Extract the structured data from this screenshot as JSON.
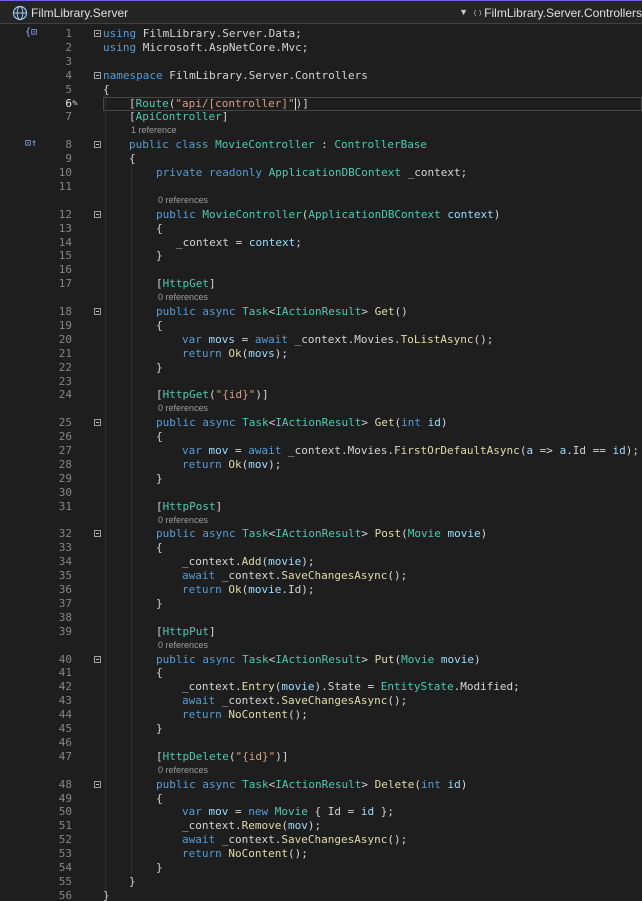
{
  "nav": {
    "project": "FilmLibrary.Server",
    "type": "FilmLibrary.Server.Controllers"
  },
  "lines": [
    {
      "n": "1",
      "indent": 0,
      "fold": true,
      "code": [
        [
          "kw",
          "using"
        ],
        [
          "t",
          " FilmLibrary.Server.Data;"
        ]
      ]
    },
    {
      "n": "2",
      "indent": 0,
      "code": [
        [
          "kw",
          "using"
        ],
        [
          "t",
          " Microsoft.AspNetCore.Mvc;"
        ]
      ]
    },
    {
      "n": "3",
      "indent": 0,
      "code": []
    },
    {
      "n": "4",
      "indent": 0,
      "fold": true,
      "code": [
        [
          "kw",
          "namespace"
        ],
        [
          "t",
          " FilmLibrary.Server.Controllers"
        ]
      ]
    },
    {
      "n": "5",
      "indent": 0,
      "code": [
        [
          "t",
          "{"
        ]
      ]
    },
    {
      "n": "6",
      "indent": 4,
      "current": true,
      "code": [
        [
          "t",
          "["
        ],
        [
          "ty",
          "Route"
        ],
        [
          "t",
          "("
        ],
        [
          "st",
          "\"api/[controller]\""
        ],
        [
          "caret",
          ""
        ],
        [
          "t",
          ")]"
        ]
      ]
    },
    {
      "n": "7",
      "indent": 4,
      "code": [
        [
          "t",
          "["
        ],
        [
          "ty",
          "ApiController"
        ],
        [
          "t",
          "]"
        ]
      ]
    },
    {
      "ref": "1 reference",
      "indent": 4
    },
    {
      "n": "8",
      "indent": 4,
      "fold": true,
      "code": [
        [
          "kw",
          "public"
        ],
        [
          "t",
          " "
        ],
        [
          "kw",
          "class"
        ],
        [
          "t",
          " "
        ],
        [
          "ty",
          "MovieController"
        ],
        [
          "t",
          " : "
        ],
        [
          "ty",
          "ControllerBase"
        ]
      ]
    },
    {
      "n": "9",
      "indent": 4,
      "code": [
        [
          "t",
          "{"
        ]
      ]
    },
    {
      "n": "10",
      "indent": 8,
      "code": [
        [
          "kw",
          "private"
        ],
        [
          "t",
          " "
        ],
        [
          "kw",
          "readonly"
        ],
        [
          "t",
          " "
        ],
        [
          "ty",
          "ApplicationDBContext"
        ],
        [
          "t",
          " _context;"
        ]
      ]
    },
    {
      "n": "11",
      "indent": 8,
      "code": []
    },
    {
      "ref": "0 references",
      "indent": 8
    },
    {
      "n": "12",
      "indent": 8,
      "fold": true,
      "code": [
        [
          "kw",
          "public"
        ],
        [
          "t",
          " "
        ],
        [
          "ty",
          "MovieController"
        ],
        [
          "t",
          "("
        ],
        [
          "ty",
          "ApplicationDBContext"
        ],
        [
          "t",
          " "
        ],
        [
          "pr",
          "context"
        ],
        [
          "t",
          ")"
        ]
      ]
    },
    {
      "n": "13",
      "indent": 8,
      "code": [
        [
          "t",
          "{"
        ]
      ]
    },
    {
      "n": "14",
      "indent": 11,
      "code": [
        [
          "t",
          "_context = "
        ],
        [
          "pr",
          "context"
        ],
        [
          "t",
          ";"
        ]
      ]
    },
    {
      "n": "15",
      "indent": 8,
      "code": [
        [
          "t",
          "}"
        ]
      ]
    },
    {
      "n": "16",
      "indent": 8,
      "code": []
    },
    {
      "n": "17",
      "indent": 8,
      "code": [
        [
          "t",
          "["
        ],
        [
          "ty",
          "HttpGet"
        ],
        [
          "t",
          "]"
        ]
      ]
    },
    {
      "ref": "0 references",
      "indent": 8
    },
    {
      "n": "18",
      "indent": 8,
      "fold": true,
      "code": [
        [
          "kw",
          "public"
        ],
        [
          "t",
          " "
        ],
        [
          "kw",
          "async"
        ],
        [
          "t",
          " "
        ],
        [
          "ty",
          "Task"
        ],
        [
          "t",
          "<"
        ],
        [
          "ty",
          "IActionResult"
        ],
        [
          "t",
          "> "
        ],
        [
          "fn",
          "Get"
        ],
        [
          "t",
          "()"
        ]
      ]
    },
    {
      "n": "19",
      "indent": 8,
      "code": [
        [
          "t",
          "{"
        ]
      ]
    },
    {
      "n": "20",
      "indent": 12,
      "code": [
        [
          "kw",
          "var"
        ],
        [
          "t",
          " "
        ],
        [
          "pr",
          "movs"
        ],
        [
          "t",
          " = "
        ],
        [
          "kw",
          "await"
        ],
        [
          "t",
          " _context.Movies."
        ],
        [
          "fn",
          "ToListAsync"
        ],
        [
          "t",
          "();"
        ]
      ]
    },
    {
      "n": "21",
      "indent": 12,
      "code": [
        [
          "kw",
          "return"
        ],
        [
          "t",
          " "
        ],
        [
          "fn",
          "Ok"
        ],
        [
          "t",
          "("
        ],
        [
          "pr",
          "movs"
        ],
        [
          "t",
          ");"
        ]
      ]
    },
    {
      "n": "22",
      "indent": 8,
      "code": [
        [
          "t",
          "}"
        ]
      ]
    },
    {
      "n": "23",
      "indent": 8,
      "code": []
    },
    {
      "n": "24",
      "indent": 8,
      "code": [
        [
          "t",
          "["
        ],
        [
          "ty",
          "HttpGet"
        ],
        [
          "t",
          "("
        ],
        [
          "st",
          "\"{id}\""
        ],
        [
          "t",
          ")]"
        ]
      ]
    },
    {
      "ref": "0 references",
      "indent": 8
    },
    {
      "n": "25",
      "indent": 8,
      "fold": true,
      "code": [
        [
          "kw",
          "public"
        ],
        [
          "t",
          " "
        ],
        [
          "kw",
          "async"
        ],
        [
          "t",
          " "
        ],
        [
          "ty",
          "Task"
        ],
        [
          "t",
          "<"
        ],
        [
          "ty",
          "IActionResult"
        ],
        [
          "t",
          "> "
        ],
        [
          "fn",
          "Get"
        ],
        [
          "t",
          "("
        ],
        [
          "kw",
          "int"
        ],
        [
          "t",
          " "
        ],
        [
          "pr",
          "id"
        ],
        [
          "t",
          ")"
        ]
      ]
    },
    {
      "n": "26",
      "indent": 8,
      "code": [
        [
          "t",
          "{"
        ]
      ]
    },
    {
      "n": "27",
      "indent": 12,
      "code": [
        [
          "kw",
          "var"
        ],
        [
          "t",
          " "
        ],
        [
          "pr",
          "mov"
        ],
        [
          "t",
          " = "
        ],
        [
          "kw",
          "await"
        ],
        [
          "t",
          " _context.Movies."
        ],
        [
          "fn",
          "FirstOrDefaultAsync"
        ],
        [
          "t",
          "("
        ],
        [
          "pr",
          "a"
        ],
        [
          "t",
          " => "
        ],
        [
          "pr",
          "a"
        ],
        [
          "t",
          ".Id == "
        ],
        [
          "pr",
          "id"
        ],
        [
          "t",
          ");"
        ]
      ]
    },
    {
      "n": "28",
      "indent": 12,
      "code": [
        [
          "kw",
          "return"
        ],
        [
          "t",
          " "
        ],
        [
          "fn",
          "Ok"
        ],
        [
          "t",
          "("
        ],
        [
          "pr",
          "mov"
        ],
        [
          "t",
          ");"
        ]
      ]
    },
    {
      "n": "29",
      "indent": 8,
      "code": [
        [
          "t",
          "}"
        ]
      ]
    },
    {
      "n": "30",
      "indent": 8,
      "code": []
    },
    {
      "n": "31",
      "indent": 8,
      "code": [
        [
          "t",
          "["
        ],
        [
          "ty",
          "HttpPost"
        ],
        [
          "t",
          "]"
        ]
      ]
    },
    {
      "ref": "0 references",
      "indent": 8
    },
    {
      "n": "32",
      "indent": 8,
      "fold": true,
      "code": [
        [
          "kw",
          "public"
        ],
        [
          "t",
          " "
        ],
        [
          "kw",
          "async"
        ],
        [
          "t",
          " "
        ],
        [
          "ty",
          "Task"
        ],
        [
          "t",
          "<"
        ],
        [
          "ty",
          "IActionResult"
        ],
        [
          "t",
          "> "
        ],
        [
          "fn",
          "Post"
        ],
        [
          "t",
          "("
        ],
        [
          "ty",
          "Movie"
        ],
        [
          "t",
          " "
        ],
        [
          "pr",
          "movie"
        ],
        [
          "t",
          ")"
        ]
      ]
    },
    {
      "n": "33",
      "indent": 8,
      "code": [
        [
          "t",
          "{"
        ]
      ]
    },
    {
      "n": "34",
      "indent": 12,
      "code": [
        [
          "t",
          "_context."
        ],
        [
          "fn",
          "Add"
        ],
        [
          "t",
          "("
        ],
        [
          "pr",
          "movie"
        ],
        [
          "t",
          ");"
        ]
      ]
    },
    {
      "n": "35",
      "indent": 12,
      "code": [
        [
          "kw",
          "await"
        ],
        [
          "t",
          " _context."
        ],
        [
          "fn",
          "SaveChangesAsync"
        ],
        [
          "t",
          "();"
        ]
      ]
    },
    {
      "n": "36",
      "indent": 12,
      "code": [
        [
          "kw",
          "return"
        ],
        [
          "t",
          " "
        ],
        [
          "fn",
          "Ok"
        ],
        [
          "t",
          "("
        ],
        [
          "pr",
          "movie"
        ],
        [
          "t",
          ".Id);"
        ]
      ]
    },
    {
      "n": "37",
      "indent": 8,
      "code": [
        [
          "t",
          "}"
        ]
      ]
    },
    {
      "n": "38",
      "indent": 8,
      "code": []
    },
    {
      "n": "39",
      "indent": 8,
      "code": [
        [
          "t",
          "["
        ],
        [
          "ty",
          "HttpPut"
        ],
        [
          "t",
          "]"
        ]
      ]
    },
    {
      "ref": "0 references",
      "indent": 8
    },
    {
      "n": "40",
      "indent": 8,
      "fold": true,
      "code": [
        [
          "kw",
          "public"
        ],
        [
          "t",
          " "
        ],
        [
          "kw",
          "async"
        ],
        [
          "t",
          " "
        ],
        [
          "ty",
          "Task"
        ],
        [
          "t",
          "<"
        ],
        [
          "ty",
          "IActionResult"
        ],
        [
          "t",
          "> "
        ],
        [
          "fn",
          "Put"
        ],
        [
          "t",
          "("
        ],
        [
          "ty",
          "Movie"
        ],
        [
          "t",
          " "
        ],
        [
          "pr",
          "movie"
        ],
        [
          "t",
          ")"
        ]
      ]
    },
    {
      "n": "41",
      "indent": 8,
      "code": [
        [
          "t",
          "{"
        ]
      ]
    },
    {
      "n": "42",
      "indent": 12,
      "code": [
        [
          "t",
          "_context."
        ],
        [
          "fn",
          "Entry"
        ],
        [
          "t",
          "("
        ],
        [
          "pr",
          "movie"
        ],
        [
          "t",
          ").State = "
        ],
        [
          "ty",
          "EntityState"
        ],
        [
          "t",
          ".Modified;"
        ]
      ]
    },
    {
      "n": "43",
      "indent": 12,
      "code": [
        [
          "kw",
          "await"
        ],
        [
          "t",
          " _context."
        ],
        [
          "fn",
          "SaveChangesAsync"
        ],
        [
          "t",
          "();"
        ]
      ]
    },
    {
      "n": "44",
      "indent": 12,
      "code": [
        [
          "kw",
          "return"
        ],
        [
          "t",
          " "
        ],
        [
          "fn",
          "NoContent"
        ],
        [
          "t",
          "();"
        ]
      ]
    },
    {
      "n": "45",
      "indent": 8,
      "code": [
        [
          "t",
          "}"
        ]
      ]
    },
    {
      "n": "46",
      "indent": 8,
      "code": []
    },
    {
      "n": "47",
      "indent": 8,
      "code": [
        [
          "t",
          "["
        ],
        [
          "ty",
          "HttpDelete"
        ],
        [
          "t",
          "("
        ],
        [
          "st",
          "\"{id}\""
        ],
        [
          "t",
          ")]"
        ]
      ]
    },
    {
      "ref": "0 references",
      "indent": 8
    },
    {
      "n": "48",
      "indent": 8,
      "fold": true,
      "code": [
        [
          "kw",
          "public"
        ],
        [
          "t",
          " "
        ],
        [
          "kw",
          "async"
        ],
        [
          "t",
          " "
        ],
        [
          "ty",
          "Task"
        ],
        [
          "t",
          "<"
        ],
        [
          "ty",
          "IActionResult"
        ],
        [
          "t",
          "> "
        ],
        [
          "fn",
          "Delete"
        ],
        [
          "t",
          "("
        ],
        [
          "kw",
          "int"
        ],
        [
          "t",
          " "
        ],
        [
          "pr",
          "id"
        ],
        [
          "t",
          ")"
        ]
      ]
    },
    {
      "n": "49",
      "indent": 8,
      "code": [
        [
          "t",
          "{"
        ]
      ]
    },
    {
      "n": "50",
      "indent": 12,
      "code": [
        [
          "kw",
          "var"
        ],
        [
          "t",
          " "
        ],
        [
          "pr",
          "mov"
        ],
        [
          "t",
          " = "
        ],
        [
          "kw",
          "new"
        ],
        [
          "t",
          " "
        ],
        [
          "ty",
          "Movie"
        ],
        [
          "t",
          " { Id = "
        ],
        [
          "pr",
          "id"
        ],
        [
          "t",
          " };"
        ]
      ]
    },
    {
      "n": "51",
      "indent": 12,
      "code": [
        [
          "t",
          "_context."
        ],
        [
          "fn",
          "Remove"
        ],
        [
          "t",
          "("
        ],
        [
          "pr",
          "mov"
        ],
        [
          "t",
          ");"
        ]
      ]
    },
    {
      "n": "52",
      "indent": 12,
      "code": [
        [
          "kw",
          "await"
        ],
        [
          "t",
          " _context."
        ],
        [
          "fn",
          "SaveChangesAsync"
        ],
        [
          "t",
          "();"
        ]
      ]
    },
    {
      "n": "53",
      "indent": 12,
      "code": [
        [
          "kw",
          "return"
        ],
        [
          "t",
          " "
        ],
        [
          "fn",
          "NoContent"
        ],
        [
          "t",
          "();"
        ]
      ]
    },
    {
      "n": "54",
      "indent": 8,
      "code": [
        [
          "t",
          "}"
        ]
      ]
    },
    {
      "n": "55",
      "indent": 4,
      "code": [
        [
          "t",
          "}"
        ]
      ]
    },
    {
      "n": "56",
      "indent": 0,
      "code": [
        [
          "t",
          "}"
        ]
      ]
    }
  ]
}
